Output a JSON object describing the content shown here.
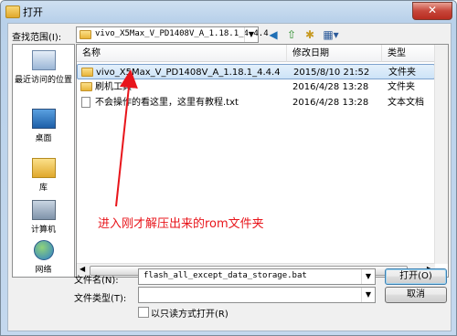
{
  "window": {
    "title": "打开",
    "close_label": "✕"
  },
  "toolbar": {
    "lookin_label": "查找范围(I):",
    "lookin_value": "vivo_X5Max_V_PD1408V_A_1.18.1_4.4.4",
    "buttons": [
      "back-icon",
      "up-folder-icon",
      "new-folder-icon",
      "view-menu-icon"
    ]
  },
  "places": [
    {
      "label": "最近访问的位置",
      "icon": "recent-places-icon"
    },
    {
      "label": "桌面",
      "icon": "desktop-icon"
    },
    {
      "label": "库",
      "icon": "libraries-icon"
    },
    {
      "label": "计算机",
      "icon": "computer-icon"
    },
    {
      "label": "网络",
      "icon": "network-icon"
    }
  ],
  "columns": {
    "name": "名称",
    "date": "修改日期",
    "type": "类型"
  },
  "files": [
    {
      "name": "vivo_X5Max_V_PD1408V_A_1.18.1_4.4.4",
      "date": "2015/8/10 21:52",
      "type": "文件夹",
      "icon": "folder-icon",
      "selected": true
    },
    {
      "name": "刷机工具",
      "date": "2016/4/28 13:28",
      "type": "文件夹",
      "icon": "folder-icon",
      "selected": false
    },
    {
      "name": "不会操作的看这里，这里有教程.txt",
      "date": "2016/4/28 13:28",
      "type": "文本文档",
      "icon": "text-file-icon",
      "selected": false
    }
  ],
  "annotation": "进入刚才解压出来的rom文件夹",
  "filename": {
    "label": "文件名(N):",
    "value": "flash_all_except_data_storage.bat"
  },
  "filetype": {
    "label": "文件类型(T):",
    "value": ""
  },
  "readonly_label": "以只读方式打开(R)",
  "buttons": {
    "open": "打开(O)",
    "cancel": "取消"
  },
  "colors": {
    "accent": "#7da2ce",
    "annotation": "#e8151b"
  }
}
